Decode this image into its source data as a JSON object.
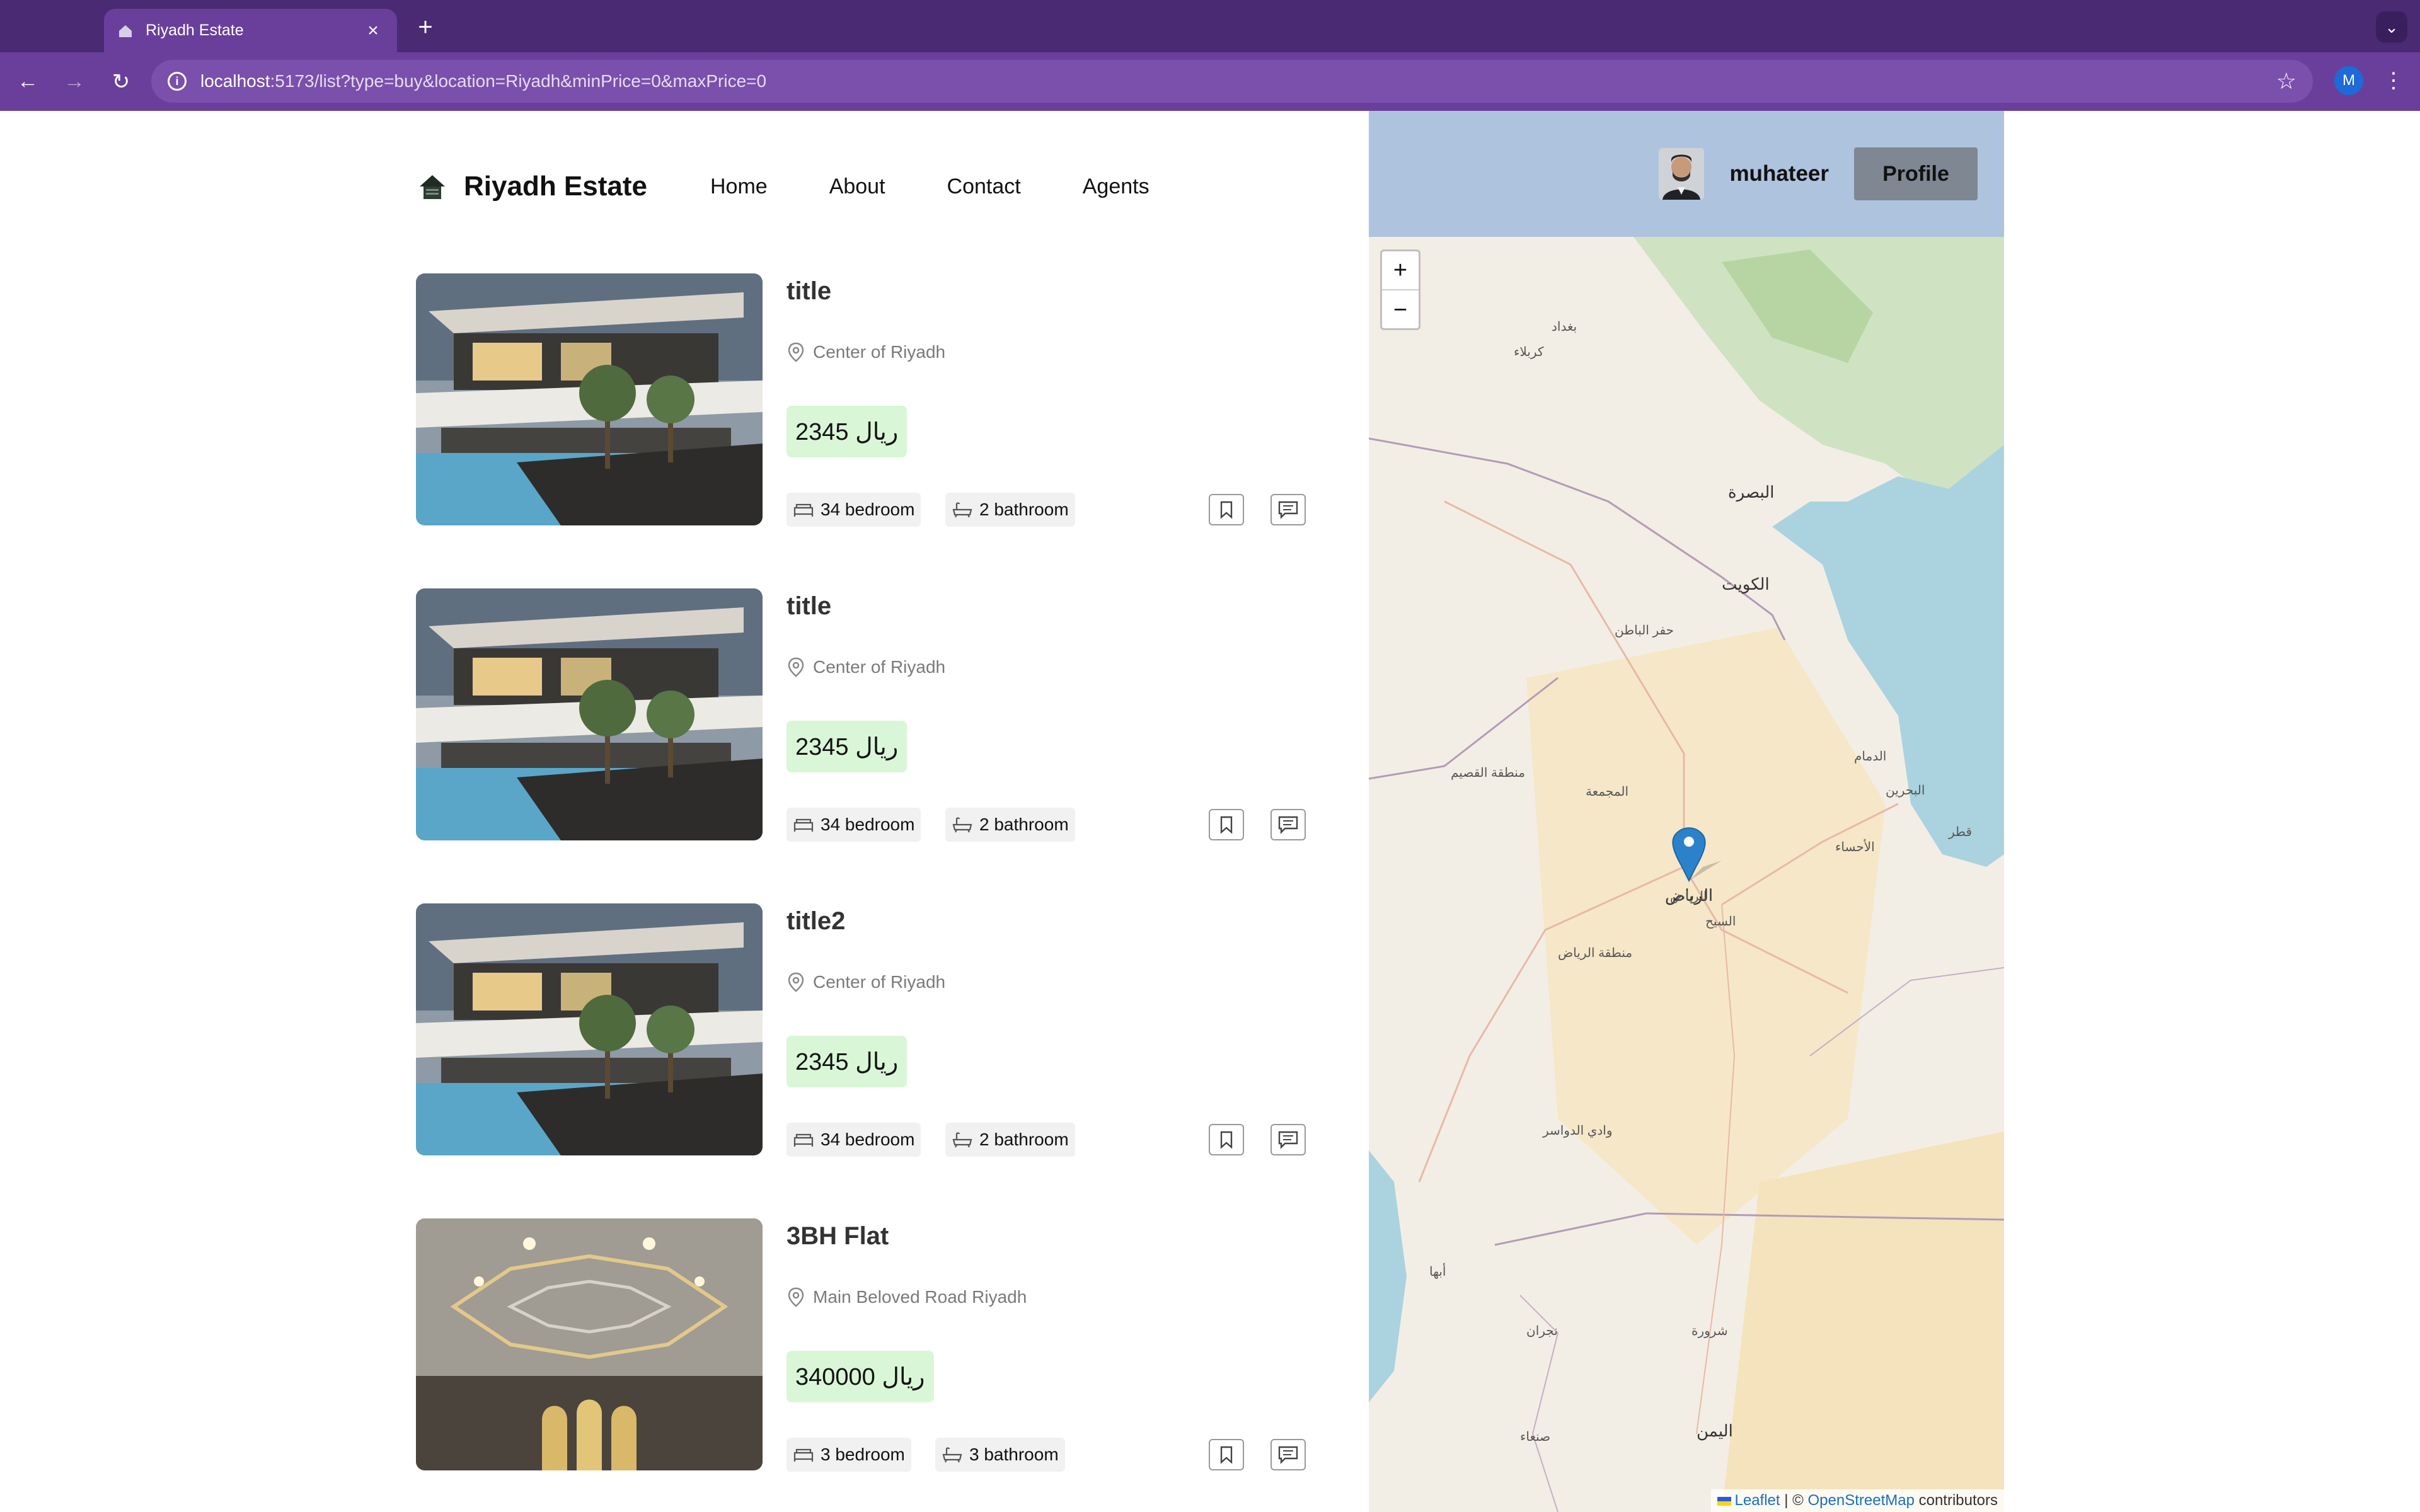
{
  "browser": {
    "tab_title": "Riyadh Estate",
    "new_tab": "+",
    "url_host": "localhost",
    "url_rest": ":5173/list?type=buy&location=Riyadh&minPrice=0&maxPrice=0",
    "profile_initial": "M"
  },
  "nav": {
    "logo_text": "Riyadh Estate",
    "links": [
      "Home",
      "About",
      "Contact",
      "Agents"
    ]
  },
  "user": {
    "name": "muhateer",
    "profile_button": "Profile"
  },
  "listings": [
    {
      "title": "title",
      "address": "Center of Riyadh",
      "price": "2345 ريال",
      "bedrooms": "34 bedroom",
      "bathrooms": "2 bathroom",
      "image": "villa-pool"
    },
    {
      "title": "title",
      "address": "Center of Riyadh",
      "price": "2345 ريال",
      "bedrooms": "34 bedroom",
      "bathrooms": "2 bathroom",
      "image": "villa-pool"
    },
    {
      "title": "title2",
      "address": "Center of Riyadh",
      "price": "2345 ريال",
      "bedrooms": "34 bedroom",
      "bathrooms": "2 bathroom",
      "image": "villa-pool"
    },
    {
      "title": "3BH Flat",
      "address": "Main Beloved Road Riyadh",
      "price": "340000 ريال",
      "bedrooms": "3 bedroom",
      "bathrooms": "3 bathroom",
      "image": "ceiling-interior"
    }
  ],
  "map": {
    "zoom_in": "+",
    "zoom_out": "−",
    "attribution_leaflet": "Leaflet",
    "attribution_sep": " | © ",
    "attribution_osm": "OpenStreetMap",
    "attribution_tail": " contributors",
    "marker_label": "الرياض",
    "labels": [
      "بغداد",
      "كربلاء",
      "البصرة",
      "الكويت",
      "حفر الباطن",
      "الدمام",
      "الأحساء",
      "البحرين",
      "قطر",
      "الرياض",
      "منطقة الرياض",
      "وادي الدواسر",
      "أبها",
      "نجران",
      "صنعاء",
      "اليمن",
      "شرورة",
      "منطقة القصيم",
      "المجمعة",
      "السيح"
    ]
  },
  "colors": {
    "browser_frame": "#4a2a72",
    "toolbar": "#6a3f9c",
    "price_bg": "#d9f7d6",
    "profile_button": "#7f8793",
    "map_bg": "#f3eee5",
    "water": "#aad3df"
  }
}
